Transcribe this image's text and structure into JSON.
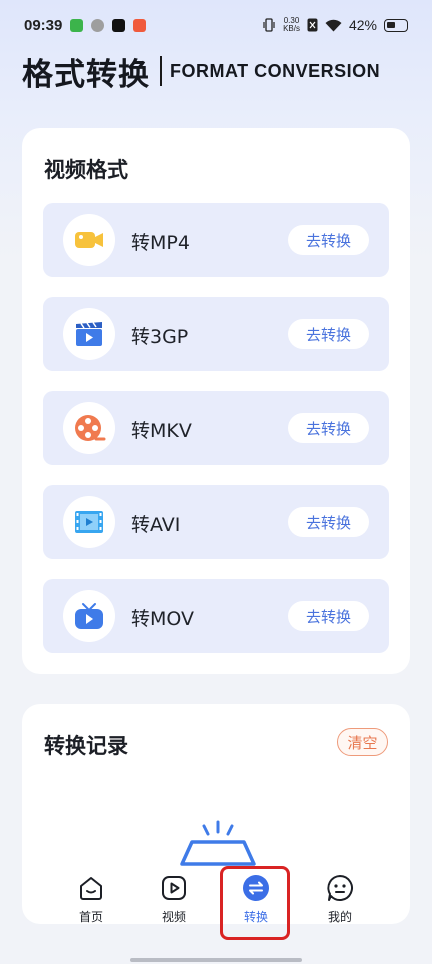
{
  "status_bar": {
    "time": "09:39",
    "net_speed_top": "0.30",
    "net_speed_bottom": "KB/s",
    "battery": "42%"
  },
  "header": {
    "title_cn": "格式转换",
    "title_en": "FORMAT CONVERSION"
  },
  "formats_section": {
    "title": "视频格式",
    "button_label": "去转换",
    "items": [
      {
        "label": "转MP4",
        "icon": "video-camera-icon"
      },
      {
        "label": "转3GP",
        "icon": "clapperboard-icon"
      },
      {
        "label": "转MKV",
        "icon": "film-reel-icon"
      },
      {
        "label": "转AVI",
        "icon": "film-strip-icon"
      },
      {
        "label": "转MOV",
        "icon": "tv-play-icon"
      }
    ]
  },
  "history_section": {
    "title": "转换记录",
    "clear_label": "清空"
  },
  "bottom_nav": {
    "items": [
      {
        "label": "首页",
        "icon": "home-icon"
      },
      {
        "label": "视频",
        "icon": "play-icon"
      },
      {
        "label": "转换",
        "icon": "convert-icon"
      },
      {
        "label": "我的",
        "icon": "profile-icon"
      }
    ],
    "active_index": 2
  },
  "colors": {
    "accent": "#3b6ee6",
    "item_bg": "#e8ecfb",
    "clear": "#e7774f",
    "highlight": "#d92323"
  }
}
